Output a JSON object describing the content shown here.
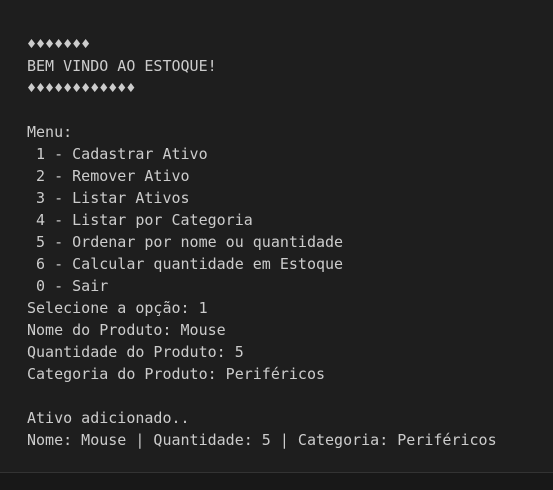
{
  "terminal": {
    "lines": [
      "♦♦♦♦♦♦♦",
      "BEM VINDO AO ESTOQUE!",
      "♦♦♦♦♦♦♦♦♦♦♦♦",
      "",
      "Menu:",
      " 1 - Cadastrar Ativo",
      " 2 - Remover Ativo",
      " 3 - Listar Ativos",
      " 4 - Listar por Categoria",
      " 5 - Ordenar por nome ou quantidade",
      " 6 - Calcular quantidade em Estoque",
      " 0 - Sair",
      "Selecione a opção: 1",
      "Nome do Produto: Mouse",
      "Quantidade do Produto: 5",
      "Categoria do Produto: Periféricos",
      "",
      "Ativo adicionado..",
      "Nome: Mouse | Quantidade: 5 | Categoria: Periféricos"
    ]
  }
}
